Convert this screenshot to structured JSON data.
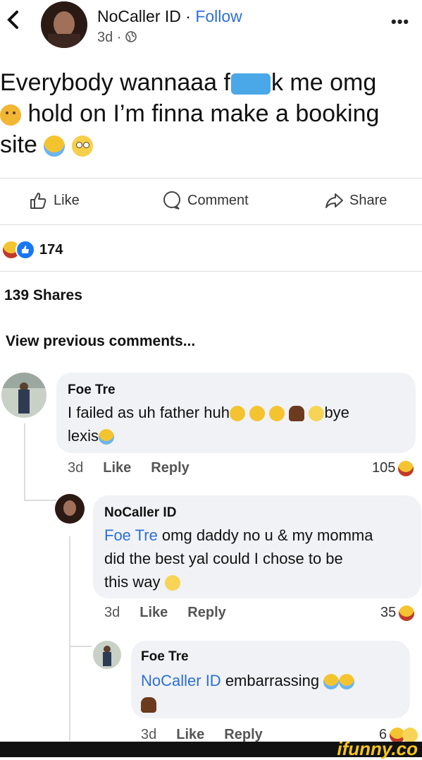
{
  "header": {
    "back_icon": "chevron-left-icon",
    "name": "NoCaller ID",
    "separator": " · ",
    "follow": "Follow",
    "time": "3d · ",
    "privacy_icon": "globe-icon",
    "more_icon": "more-horizontal-icon",
    "more_label": "•••"
  },
  "post": {
    "line1_a": "Everybody wannaaa f",
    "line1_b": "k me omg",
    "line2": " hold on I’m finna make a booking",
    "line3": "site "
  },
  "actions": {
    "like": "Like",
    "comment": "Comment",
    "share": "Share"
  },
  "stats": {
    "reactions": "174",
    "shares": "139 Shares"
  },
  "view_previous": "View previous comments...",
  "comments": [
    {
      "name": "Foe Tre",
      "text_a": "I failed as uh father huh",
      "text_b": "bye",
      "text_c": "lexis",
      "time": "3d",
      "like": "Like",
      "reply": "Reply",
      "count": "105"
    },
    {
      "name": "NoCaller ID",
      "mention": "Foe Tre",
      "text_a": " omg daddy no u & my momma",
      "text_b": "did the best yal could I chose to be",
      "text_c": "this way ",
      "time": "3d",
      "like": "Like",
      "reply": "Reply",
      "count": "35"
    },
    {
      "name": "Foe Tre",
      "mention": "NoCaller ID",
      "text_a": " embarrassing ",
      "time": "3d",
      "like": "Like",
      "reply": "Reply",
      "count": "6"
    }
  ],
  "watermark": "ifunny.co",
  "colors": {
    "link_blue": "#2d6fd6",
    "bubble_gray": "#f0f2f5",
    "emoji_yellow": "#f4c430",
    "like_blue": "#1877f2"
  }
}
